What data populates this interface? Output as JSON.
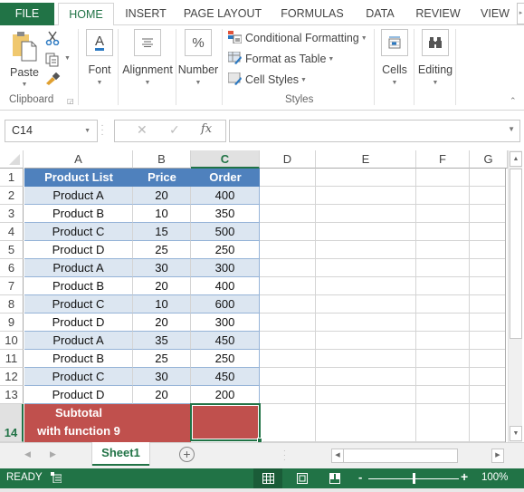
{
  "ribbon": {
    "tabs": [
      {
        "label": "FILE"
      },
      {
        "label": "HOME"
      },
      {
        "label": "INSERT"
      },
      {
        "label": "PAGE LAYOUT"
      },
      {
        "label": "FORMULAS"
      },
      {
        "label": "DATA"
      },
      {
        "label": "REVIEW"
      },
      {
        "label": "VIEW"
      }
    ],
    "active_tab": "HOME",
    "clipboard": {
      "paste_label": "Paste",
      "group_label": "Clipboard"
    },
    "font_label": "Font",
    "alignment_label": "Alignment",
    "number_label": "Number",
    "number_icon": "%",
    "styles": {
      "items": [
        {
          "label": "Conditional Formatting"
        },
        {
          "label": "Format as Table"
        },
        {
          "label": "Cell Styles"
        }
      ],
      "group_label": "Styles"
    },
    "cells_label": "Cells",
    "editing_label": "Editing"
  },
  "formula_bar": {
    "name_box": "C14",
    "fx_label": "fx",
    "formula": ""
  },
  "grid": {
    "columns": [
      "A",
      "B",
      "C",
      "D",
      "E",
      "F",
      "G"
    ],
    "selected_column": "C",
    "rows": [
      "1",
      "2",
      "3",
      "4",
      "5",
      "6",
      "7",
      "8",
      "9",
      "10",
      "11",
      "12",
      "13",
      "14"
    ],
    "selected_row": "14",
    "table": {
      "headers": [
        "Product List",
        "Price",
        "Order"
      ],
      "rows": [
        [
          "Product A",
          "20",
          "400"
        ],
        [
          "Product B",
          "10",
          "350"
        ],
        [
          "Product C",
          "15",
          "500"
        ],
        [
          "Product D",
          "25",
          "250"
        ],
        [
          "Product A",
          "30",
          "300"
        ],
        [
          "Product B",
          "20",
          "400"
        ],
        [
          "Product C",
          "10",
          "600"
        ],
        [
          "Product D",
          "20",
          "300"
        ],
        [
          "Product A",
          "35",
          "450"
        ],
        [
          "Product B",
          "25",
          "250"
        ],
        [
          "Product C",
          "30",
          "450"
        ],
        [
          "Product D",
          "20",
          "200"
        ]
      ],
      "subtotal_line1": "Subtotal",
      "subtotal_line2": "with function 9"
    },
    "colors": {
      "header": "#4f81bd",
      "band": "#dce6f1",
      "subtotal": "#c0504d",
      "accent": "#217346"
    }
  },
  "sheets": {
    "tabs": [
      {
        "label": "Sheet1"
      }
    ],
    "add_label": "+"
  },
  "status": {
    "state": "READY",
    "zoom": "100%",
    "zoom_level_fraction": 0.5
  }
}
